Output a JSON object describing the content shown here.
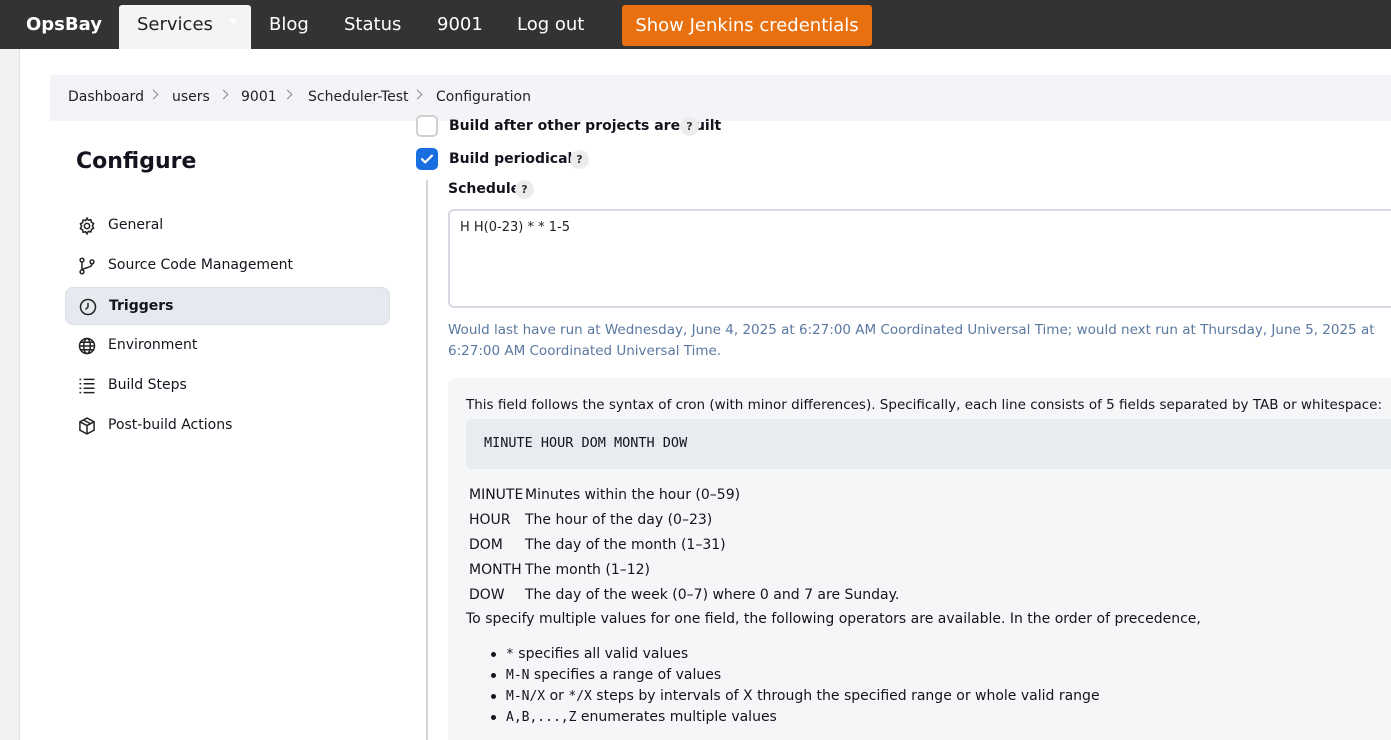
{
  "nav": {
    "brand": "OpsBay",
    "items": [
      "Services",
      "Blog",
      "Status",
      "9001",
      "Log out"
    ],
    "jenkins_button": "Show Jenkins credentials"
  },
  "breadcrumb": [
    "Dashboard",
    "users",
    "9001",
    "Scheduler-Test",
    "Configuration"
  ],
  "sidebar": {
    "title": "Configure",
    "items": [
      {
        "label": "General",
        "icon": "gear-icon"
      },
      {
        "label": "Source Code Management",
        "icon": "branch-icon"
      },
      {
        "label": "Triggers",
        "icon": "clock-icon",
        "active": true
      },
      {
        "label": "Environment",
        "icon": "globe-icon"
      },
      {
        "label": "Build Steps",
        "icon": "list-icon"
      },
      {
        "label": "Post-build Actions",
        "icon": "package-icon"
      }
    ]
  },
  "triggers": {
    "build_after_label": "Build after other projects are built",
    "build_after_checked": false,
    "build_periodically_label": "Build periodically",
    "build_periodically_checked": true,
    "schedule_label": "Schedule",
    "schedule_value": "H H(0-23) * * 1-5",
    "run_info": "Would last have run at Wednesday, June 4, 2025 at 6:27:00 AM Coordinated Universal Time; would next run at Thursday, June 5, 2025 at 6:27:00 AM Coordinated Universal Time."
  },
  "help": {
    "intro": "This field follows the syntax of cron (with minor differences). Specifically, each line consists of 5 fields separated by TAB or whitespace:",
    "code": "MINUTE HOUR DOM MONTH DOW",
    "fields": [
      {
        "key": "MINUTE",
        "desc": "Minutes within the hour (0–59)"
      },
      {
        "key": "HOUR",
        "desc": "The hour of the day (0–23)"
      },
      {
        "key": "DOM",
        "desc": "The day of the month (1–31)"
      },
      {
        "key": "MONTH",
        "desc": "The month (1–12)"
      },
      {
        "key": "DOW",
        "desc": "The day of the week (0–7) where 0 and 7 are Sunday."
      }
    ],
    "ops_intro": "To specify multiple values for one field, the following operators are available. In the order of precedence,",
    "operators": [
      {
        "code": "*",
        "text": " specifies all valid values"
      },
      {
        "code": "M-N",
        "text": " specifies a range of values"
      },
      {
        "code": "M-N/X",
        "mid": " or ",
        "code2": "*/X",
        "text": " steps by intervals of X through the specified range or whole valid range"
      },
      {
        "code": "A,B,...,Z",
        "text": " enumerates multiple values"
      }
    ]
  },
  "colors": {
    "topbar": "#333333",
    "accent_button": "#e8700e",
    "checkbox_checked": "#1a6fe0",
    "run_info_text": "#5a78a0"
  }
}
